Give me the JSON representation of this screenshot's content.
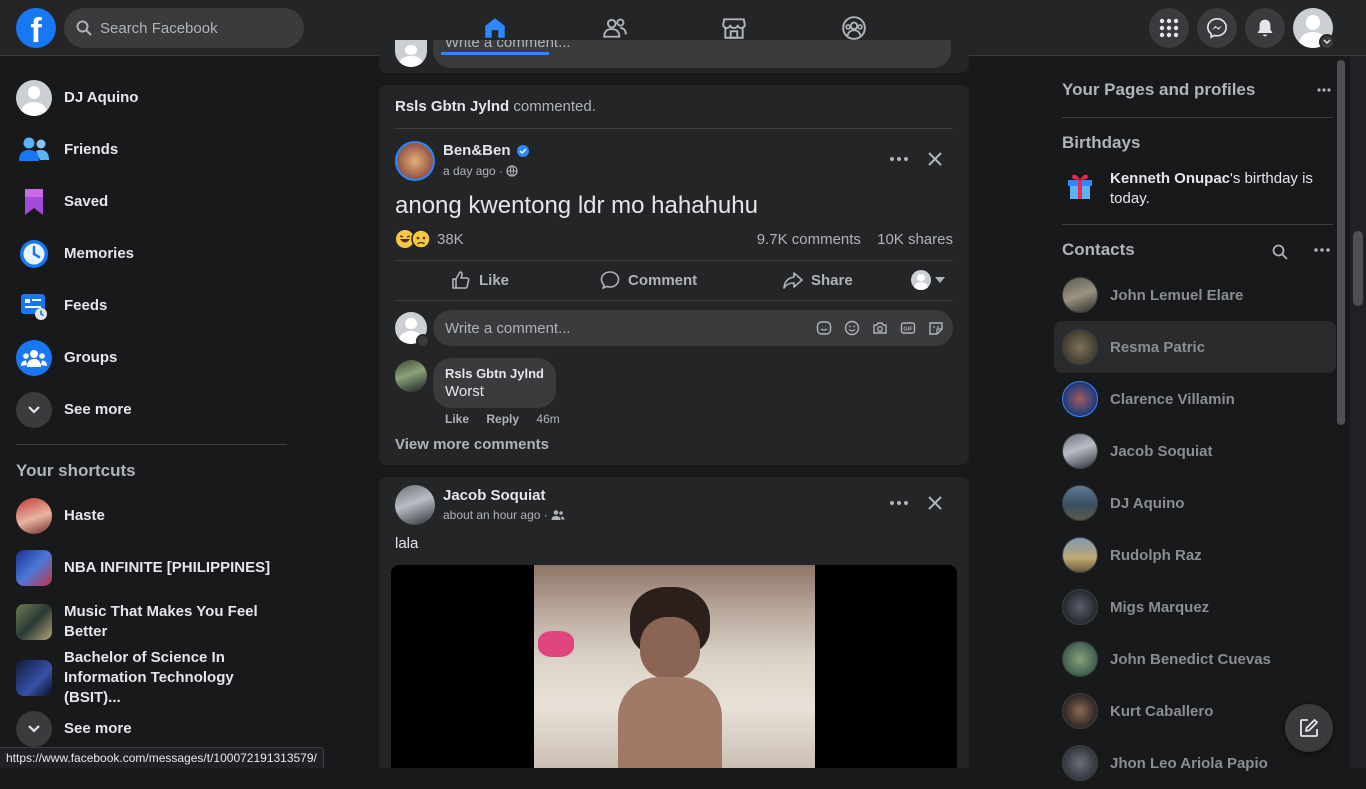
{
  "header": {
    "search_placeholder": "Search Facebook",
    "logo_letter": "f"
  },
  "left_nav": {
    "items": [
      {
        "label": "DJ Aquino"
      },
      {
        "label": "Friends"
      },
      {
        "label": "Saved"
      },
      {
        "label": "Memories"
      },
      {
        "label": "Feeds"
      },
      {
        "label": "Groups"
      },
      {
        "label": "See more"
      }
    ],
    "shortcuts_title": "Your shortcuts",
    "shortcuts": [
      {
        "label": "Haste"
      },
      {
        "label": "NBA INFINITE [PHILIPPINES]"
      },
      {
        "label": "Music That Makes You Feel Better"
      },
      {
        "label": "Bachelor of Science In Information Technology (BSIT)..."
      }
    ],
    "see_more_2": "See more"
  },
  "feed": {
    "top_comment_placeholder": "Write a comment...",
    "post1": {
      "activity_name": "Rsls Gbtn Jylnd",
      "activity_text": " commented.",
      "author": "Ben&Ben",
      "time": "a day ago",
      "separator": " · ",
      "text": "anong kwentong ldr mo hahahuhu",
      "reaction_count": "38K",
      "comments_count": "9.7K comments",
      "shares_count": "10K shares",
      "like_label": "Like",
      "comment_label": "Comment",
      "share_label": "Share",
      "comment_placeholder": "Write a comment...",
      "comment": {
        "author": "Rsls Gbtn Jylnd",
        "text": "Worst",
        "like": "Like",
        "reply": "Reply",
        "time": "46m"
      },
      "view_more": "View more comments"
    },
    "post2": {
      "author": "Jacob Soquiat",
      "time": "about an hour ago",
      "separator": " · ",
      "text": "lala"
    }
  },
  "right_panel": {
    "pages_title": "Your Pages and profiles",
    "birthdays_title": "Birthdays",
    "birthday_name": "Kenneth Onupac",
    "birthday_text": "'s birthday is today.",
    "contacts_title": "Contacts",
    "contacts": [
      {
        "name": "John Lemuel Elare"
      },
      {
        "name": "Resma Patric"
      },
      {
        "name": "Clarence Villamin"
      },
      {
        "name": "Jacob Soquiat"
      },
      {
        "name": "DJ Aquino"
      },
      {
        "name": "Rudolph Raz"
      },
      {
        "name": "Migs Marquez"
      },
      {
        "name": "John Benedict Cuevas"
      },
      {
        "name": "Kurt Caballero"
      },
      {
        "name": "Jhon Leo Ariola Papio"
      }
    ]
  },
  "status_url": "https://www.facebook.com/messages/t/100072191313579/",
  "colors": {
    "background": "#18191a",
    "surface": "#242526",
    "accent": "#2d88ff",
    "text": "#e4e6eb",
    "secondary_text": "#b0b3b8"
  }
}
